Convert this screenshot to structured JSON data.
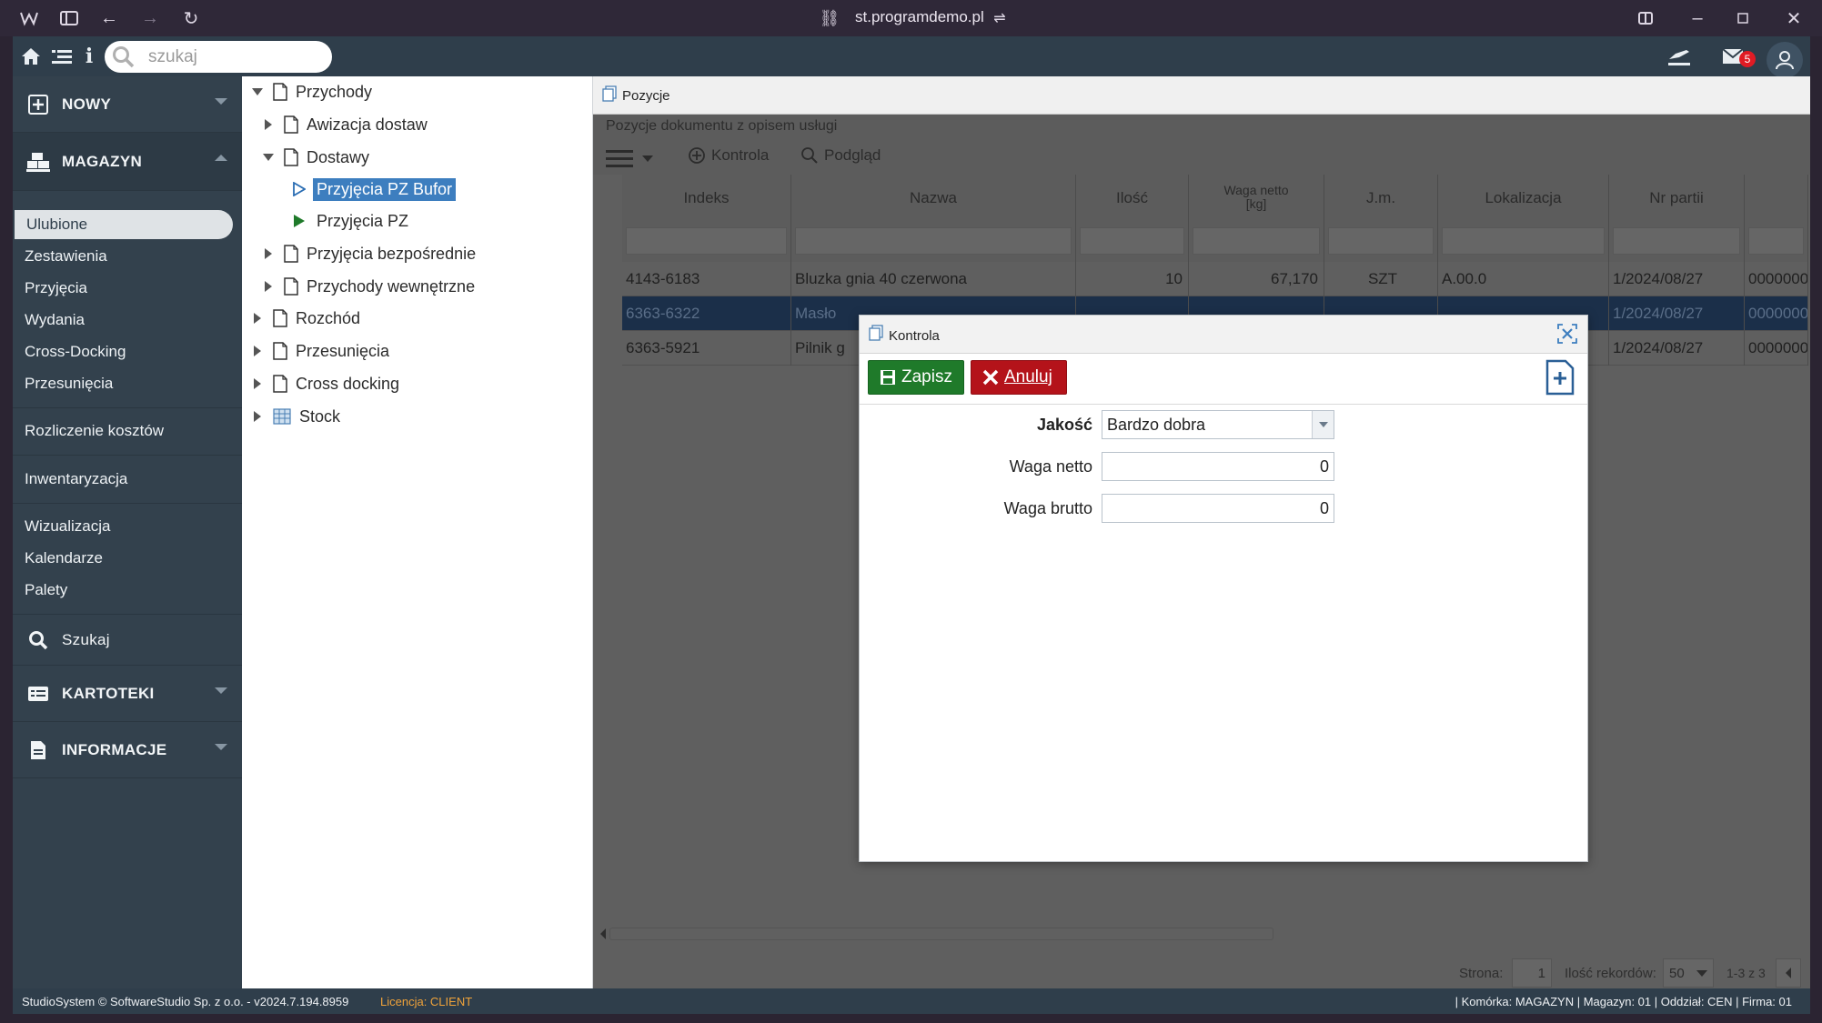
{
  "browser": {
    "url": "st.programdemo.pl"
  },
  "toolbar": {
    "search_placeholder": "szukaj",
    "mail_count": "5"
  },
  "sidebar": {
    "new_label": "NOWY",
    "magazyn_label": "MAGAZYN",
    "items_group1": [
      "Ulubione",
      "Zestawienia",
      "Przyjęcia",
      "Wydania",
      "Cross-Docking",
      "Przesunięcia"
    ],
    "item_costs": "Rozliczenie kosztów",
    "item_inventory": "Inwentaryzacja",
    "items_group2": [
      "Wizualizacja",
      "Kalendarze",
      "Palety"
    ],
    "search_label": "Szukaj",
    "kartoteki_label": "KARTOTEKI",
    "informacje_label": "INFORMACJE"
  },
  "tree": {
    "items": [
      {
        "label": "Przychody"
      },
      {
        "label": "Awizacja dostaw"
      },
      {
        "label": "Dostawy"
      },
      {
        "label": "Przyjęcia PZ Bufor"
      },
      {
        "label": "Przyjęcia PZ"
      },
      {
        "label": "Przyjęcia bezpośrednie"
      },
      {
        "label": "Przychody wewnętrzne"
      },
      {
        "label": "Rozchód"
      },
      {
        "label": "Przesunięcia"
      },
      {
        "label": "Cross docking"
      },
      {
        "label": "Stock"
      }
    ]
  },
  "content": {
    "title": "Pozycje",
    "subheader": "Pozycje dokumentu z opisem usługi",
    "kontrola_btn": "Kontrola",
    "podglad_btn": "Podgląd",
    "columns": [
      "Indeks",
      "Nazwa",
      "Ilość",
      "Waga netto [kg]",
      "J.m.",
      "Lokalizacja",
      "Nr partii",
      ""
    ],
    "rows": [
      [
        "4143-6183",
        "Bluzka gnia 40 czerwona",
        "10",
        "67,170",
        "SZT",
        "A.00.0",
        "1/2024/08/27",
        "0000000"
      ],
      [
        "6363-6322",
        "Masło",
        "",
        "",
        "",
        "",
        "1/2024/08/27",
        "0000000"
      ],
      [
        "6363-5921",
        "Pilnik g",
        "",
        "",
        "",
        "",
        "1/2024/08/27",
        "0000000"
      ]
    ],
    "pager": {
      "page_label": "Strona:",
      "page_value": "1",
      "records_label": "Ilość rekordów:",
      "records_value": "50",
      "range": "1-3 z 3"
    }
  },
  "modal": {
    "title": "Kontrola",
    "save_label": "Zapisz",
    "cancel_label": "Anuluj",
    "fields": {
      "quality_label": "Jakość",
      "quality_value": "Bardzo dobra",
      "net_label": "Waga netto",
      "net_value": "0",
      "gross_label": "Waga brutto",
      "gross_value": "0"
    }
  },
  "status": {
    "left": "StudioSystem © SoftwareStudio Sp. z o.o. - v2024.7.194.8959",
    "license": "Licencja: CLIENT",
    "right": "| Komórka: MAGAZYN | Magazyn: 01 | Oddział: CEN | Firma: 01"
  }
}
